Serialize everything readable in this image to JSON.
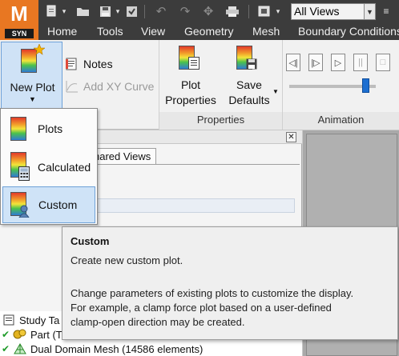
{
  "app": {
    "logo_letter": "M",
    "logo_sub": "SYN",
    "view_selector": "All Views"
  },
  "tabs": [
    {
      "label": "Home"
    },
    {
      "label": "Tools"
    },
    {
      "label": "View"
    },
    {
      "label": "Geometry"
    },
    {
      "label": "Mesh"
    },
    {
      "label": "Boundary Conditions"
    }
  ],
  "ribbon": {
    "new_plot_label": "New Plot",
    "notes_label": "Notes",
    "add_xy_label": "Add XY Curve",
    "plot_properties_line1": "Plot",
    "plot_properties_line2": "Properties",
    "save_defaults_line1": "Save",
    "save_defaults_line2": "Defaults",
    "group_properties": "Properties",
    "group_animation": "Animation"
  },
  "dropdown": {
    "items": [
      {
        "label": "Plots"
      },
      {
        "label": "Calculated"
      },
      {
        "label": "Custom"
      }
    ]
  },
  "panel": {
    "tab_label": "Shared Views",
    "tab_visible_text": "hared Views"
  },
  "tree": {
    "items": [
      {
        "label": "Study Ta"
      },
      {
        "label": "Part (T"
      },
      {
        "label": "Dual Domain Mesh (14586 elements)"
      }
    ]
  },
  "tooltip": {
    "title": "Custom",
    "line1": "Create new custom plot.",
    "line2": "Change parameters of existing plots to customize the display.",
    "line3": "For example, a clamp force plot based on a user-defined",
    "line4": "clamp-open direction may be created."
  },
  "colors": {
    "accent": "#e87722",
    "titlebar": "#3c3c3c",
    "highlight": "#cfe3f7"
  }
}
